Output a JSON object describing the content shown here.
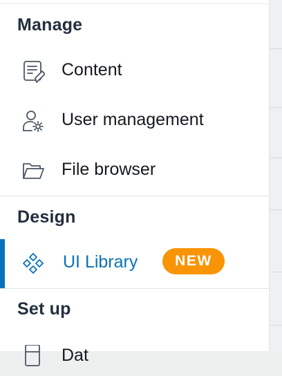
{
  "nav": {
    "sections": [
      {
        "heading": "Manage",
        "items": [
          {
            "label": "Content",
            "icon": "content-icon"
          },
          {
            "label": "User management",
            "icon": "user-settings-icon"
          },
          {
            "label": "File browser",
            "icon": "folder-icon"
          }
        ]
      },
      {
        "heading": "Design",
        "items": [
          {
            "label": "UI Library",
            "icon": "ui-library-icon",
            "badge": "NEW",
            "active": true
          }
        ]
      },
      {
        "heading": "Set up",
        "items": [
          {
            "label": "Dat",
            "icon": "database-icon"
          }
        ]
      }
    ]
  },
  "colors": {
    "heading": "#232f3e",
    "active": "#0a73b6",
    "badge": "#f89406",
    "icon": "#4a5563"
  }
}
